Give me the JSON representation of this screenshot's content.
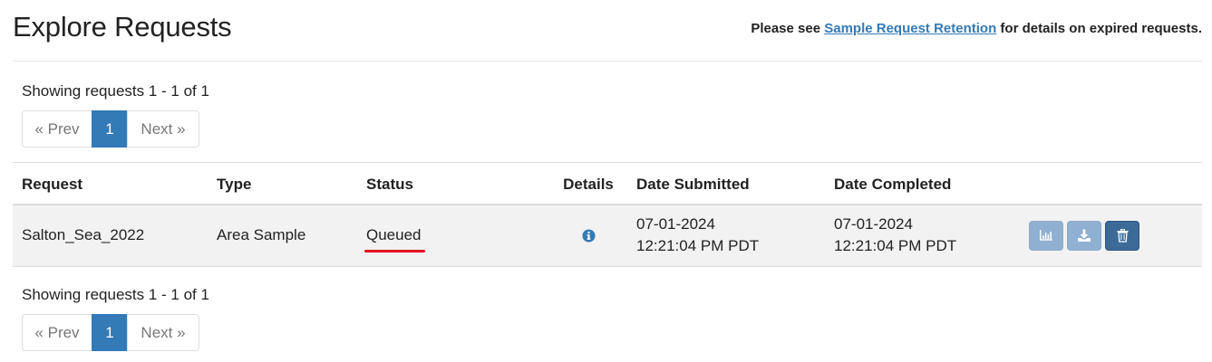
{
  "header": {
    "title": "Explore Requests",
    "retention_prefix": "Please see ",
    "retention_link": "Sample Request Retention",
    "retention_suffix": " for details on expired requests."
  },
  "pagination": {
    "showing_text": "Showing requests 1 - 1 of 1",
    "prev_label": "« Prev",
    "current_page": "1",
    "next_label": "Next »"
  },
  "table": {
    "headers": {
      "request": "Request",
      "type": "Type",
      "status": "Status",
      "details": "Details",
      "date_submitted": "Date Submitted",
      "date_completed": "Date Completed"
    },
    "rows": [
      {
        "request": "Salton_Sea_2022",
        "type": "Area Sample",
        "status": "Queued",
        "submitted_date": "07-01-2024",
        "submitted_time": "12:21:04 PM PDT",
        "completed_date": "07-01-2024",
        "completed_time": "12:21:04 PM PDT",
        "details_icon": "info-circle-icon",
        "actions": [
          "bar-chart-icon",
          "download-icon",
          "trash-icon"
        ]
      }
    ]
  },
  "colors": {
    "link": "#337ab7",
    "active_page": "#337ab7",
    "status_annotation": "#e4121b",
    "action_light": "#8fb0d1",
    "action_dark": "#3d6b98"
  }
}
